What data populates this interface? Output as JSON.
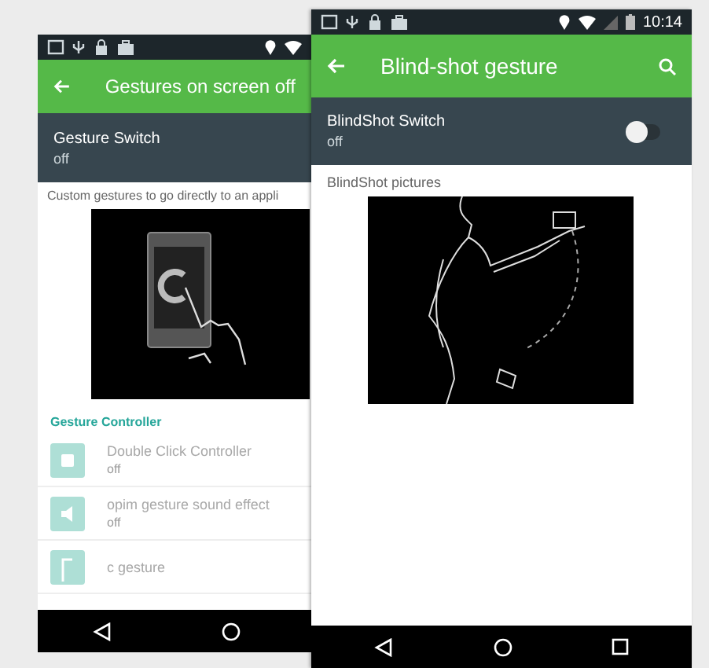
{
  "back_screen": {
    "title": "Gestures on screen off",
    "switch": {
      "label": "Gesture Switch",
      "value": "off"
    },
    "description": "Custom gestures to go directly to an appli",
    "section": "Gesture Controller",
    "items": [
      {
        "kind": "double-click",
        "title": "Double Click Controller",
        "subtitle": "off",
        "disabled": true
      },
      {
        "kind": "sound",
        "title": "opim gesture sound effect",
        "subtitle": "off",
        "disabled": true
      },
      {
        "kind": "letter",
        "title": "c gesture",
        "disabled": true
      }
    ]
  },
  "front_screen": {
    "time": "10:14",
    "title": "Blind-shot gesture",
    "switch": {
      "label": "BlindShot Switch",
      "value": "off",
      "on": false
    },
    "section": "BlindShot pictures"
  }
}
